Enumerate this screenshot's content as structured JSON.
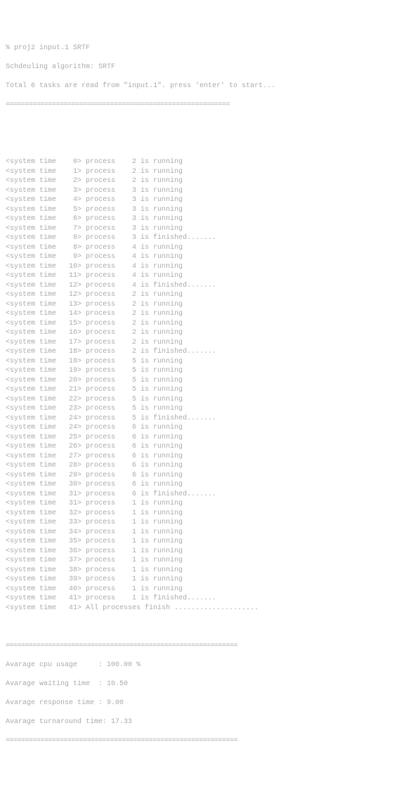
{
  "header": {
    "command": "% proj2 input.1 SRTF",
    "algo_line": "Schdeuling algorithm: SRTF",
    "load_line": "Total 6 tasks are read from \"input.1\". press 'enter' to start...",
    "divider": "=========================================================="
  },
  "log": [
    {
      "time": 0,
      "pid": 2,
      "status": "is running"
    },
    {
      "time": 1,
      "pid": 2,
      "status": "is running"
    },
    {
      "time": 2,
      "pid": 2,
      "status": "is running"
    },
    {
      "time": 3,
      "pid": 3,
      "status": "is running"
    },
    {
      "time": 4,
      "pid": 3,
      "status": "is running"
    },
    {
      "time": 5,
      "pid": 3,
      "status": "is running"
    },
    {
      "time": 6,
      "pid": 3,
      "status": "is running"
    },
    {
      "time": 7,
      "pid": 3,
      "status": "is running"
    },
    {
      "time": 8,
      "pid": 3,
      "status": "is finished......."
    },
    {
      "time": 8,
      "pid": 4,
      "status": "is running"
    },
    {
      "time": 9,
      "pid": 4,
      "status": "is running"
    },
    {
      "time": 10,
      "pid": 4,
      "status": "is running"
    },
    {
      "time": 11,
      "pid": 4,
      "status": "is running"
    },
    {
      "time": 12,
      "pid": 4,
      "status": "is finished......."
    },
    {
      "time": 12,
      "pid": 2,
      "status": "is running"
    },
    {
      "time": 13,
      "pid": 2,
      "status": "is running"
    },
    {
      "time": 14,
      "pid": 2,
      "status": "is running"
    },
    {
      "time": 15,
      "pid": 2,
      "status": "is running"
    },
    {
      "time": 16,
      "pid": 2,
      "status": "is running"
    },
    {
      "time": 17,
      "pid": 2,
      "status": "is running"
    },
    {
      "time": 18,
      "pid": 2,
      "status": "is finished......."
    },
    {
      "time": 18,
      "pid": 5,
      "status": "is running"
    },
    {
      "time": 19,
      "pid": 5,
      "status": "is running"
    },
    {
      "time": 20,
      "pid": 5,
      "status": "is running"
    },
    {
      "time": 21,
      "pid": 5,
      "status": "is running"
    },
    {
      "time": 22,
      "pid": 5,
      "status": "is running"
    },
    {
      "time": 23,
      "pid": 5,
      "status": "is running"
    },
    {
      "time": 24,
      "pid": 5,
      "status": "is finished......."
    },
    {
      "time": 24,
      "pid": 6,
      "status": "is running"
    },
    {
      "time": 25,
      "pid": 6,
      "status": "is running"
    },
    {
      "time": 26,
      "pid": 6,
      "status": "is running"
    },
    {
      "time": 27,
      "pid": 6,
      "status": "is running"
    },
    {
      "time": 28,
      "pid": 6,
      "status": "is running"
    },
    {
      "time": 29,
      "pid": 6,
      "status": "is running"
    },
    {
      "time": 30,
      "pid": 6,
      "status": "is running"
    },
    {
      "time": 31,
      "pid": 6,
      "status": "is finished......."
    },
    {
      "time": 31,
      "pid": 1,
      "status": "is running"
    },
    {
      "time": 32,
      "pid": 1,
      "status": "is running"
    },
    {
      "time": 33,
      "pid": 1,
      "status": "is running"
    },
    {
      "time": 34,
      "pid": 1,
      "status": "is running"
    },
    {
      "time": 35,
      "pid": 1,
      "status": "is running"
    },
    {
      "time": 36,
      "pid": 1,
      "status": "is running"
    },
    {
      "time": 37,
      "pid": 1,
      "status": "is running"
    },
    {
      "time": 38,
      "pid": 1,
      "status": "is running"
    },
    {
      "time": 39,
      "pid": 1,
      "status": "is running"
    },
    {
      "time": 40,
      "pid": 1,
      "status": "is running"
    },
    {
      "time": 41,
      "pid": 1,
      "status": "is finished......."
    }
  ],
  "final_line": {
    "time": 41,
    "text": "All processes finish ...................."
  },
  "summary": {
    "divider": "============================================================",
    "cpu_usage_label": "Avarage cpu usage     :",
    "cpu_usage_value": "100.00 %",
    "waiting_label": "Avarage waiting time  :",
    "waiting_value": "10.50",
    "response_label": "Avarage response time :",
    "response_value": "9.00",
    "turnaround_label": "Avarage turnaround time:",
    "turnaround_value": "17.33"
  }
}
